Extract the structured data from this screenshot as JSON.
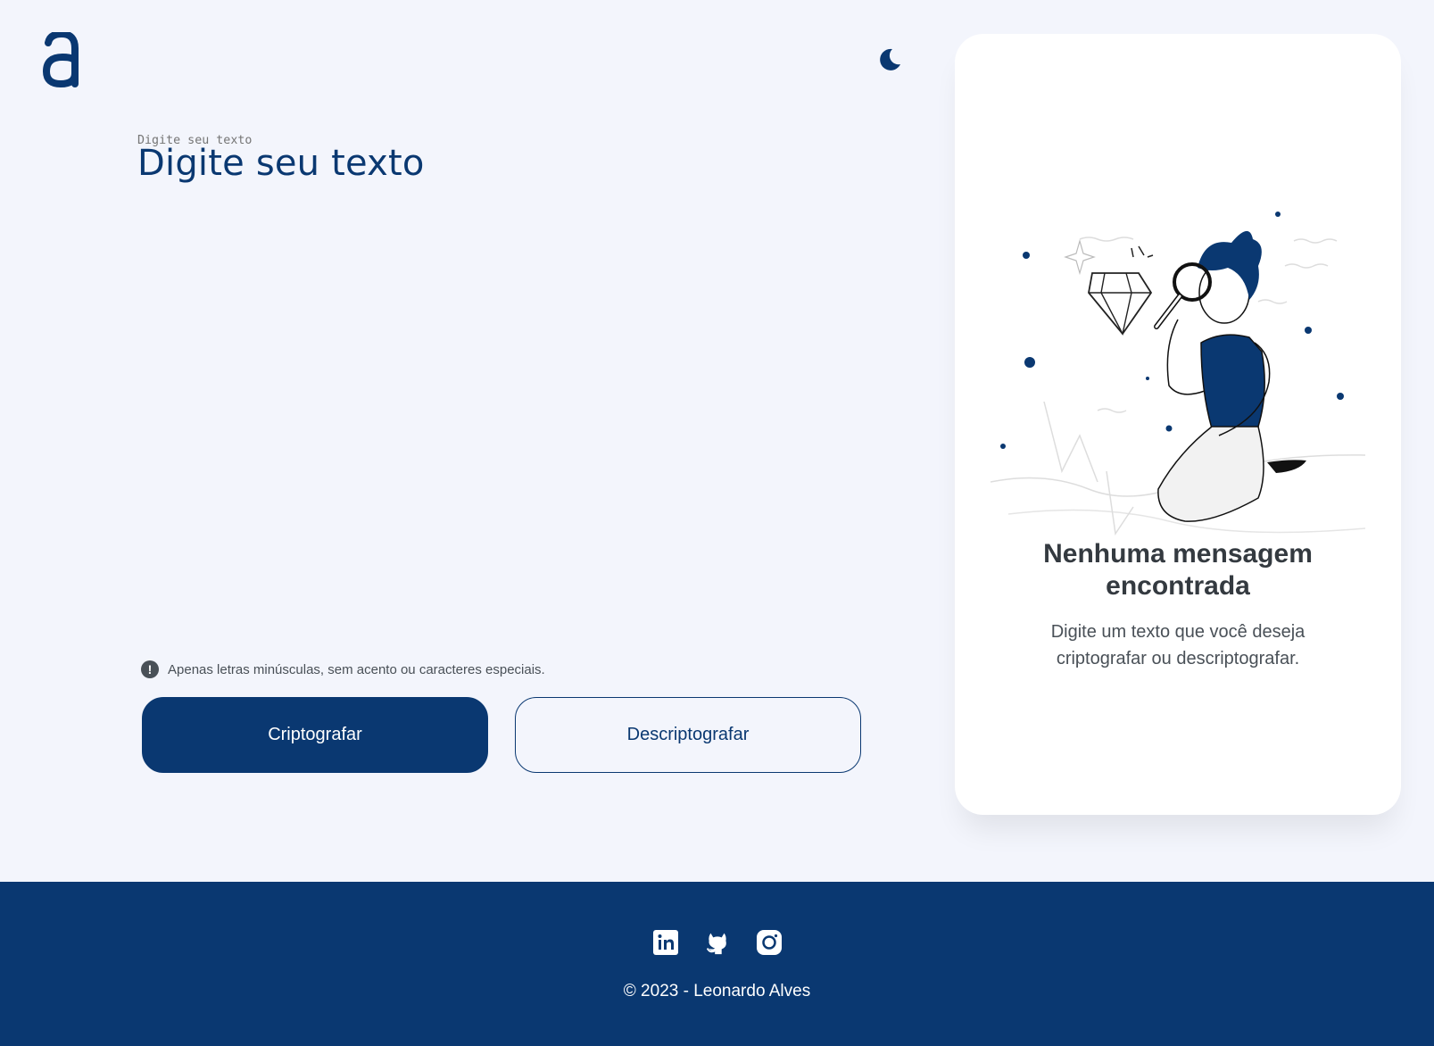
{
  "header": {
    "logo_icon": "alura-logo-icon",
    "theme_toggle_icon": "moon-icon"
  },
  "input": {
    "placeholder": "Digite seu texto",
    "value": ""
  },
  "hint": {
    "icon": "exclamation-circle-icon",
    "text": "Apenas letras minúsculas, sem acento ou caracteres especiais."
  },
  "buttons": {
    "encrypt_label": "Criptografar",
    "decrypt_label": "Descriptografar"
  },
  "output": {
    "illustration": "person-with-magnifier-illustration",
    "empty_title": "Nenhuma mensagem encontrada",
    "empty_description": "Digite um texto que você deseja criptografar ou descriptografar."
  },
  "footer": {
    "social": [
      "linkedin-icon",
      "github-icon",
      "instagram-icon"
    ],
    "copyright": "© 2023 - Leonardo Alves"
  },
  "colors": {
    "primary": "#0a3871",
    "background": "#f3f5fc",
    "card": "#ffffff",
    "title_text": "#343a40",
    "body_text": "#495057"
  }
}
